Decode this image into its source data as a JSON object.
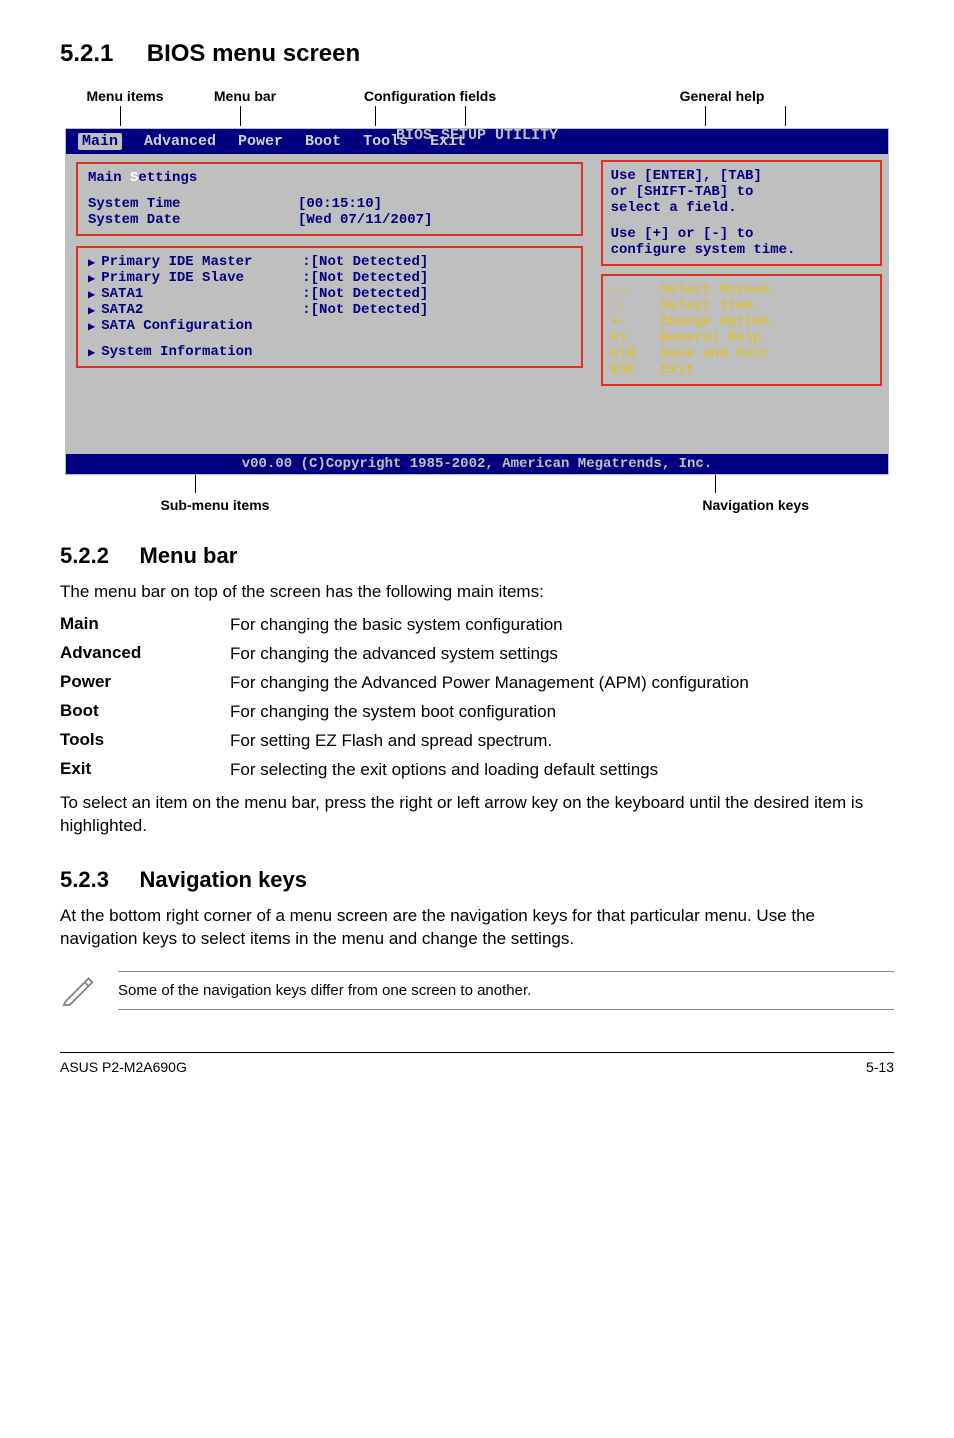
{
  "section": {
    "s1_num": "5.2.1",
    "s1_title": "BIOS menu screen",
    "s2_num": "5.2.2",
    "s2_title": "Menu bar",
    "s2_intro": "The menu bar on top of the screen has the following main items:",
    "s2_outro": "To select an item on the menu bar, press the right or left arrow key on the keyboard until the desired item is highlighted.",
    "s3_num": "5.2.3",
    "s3_title": "Navigation keys",
    "s3_body": "At the bottom right corner of a menu screen are the navigation keys for that particular menu. Use the navigation keys to select items in the menu and change the settings.",
    "note": "Some of the navigation keys differ from one screen to another."
  },
  "top_labels": {
    "menu_items": "Menu items",
    "menu_bar": "Menu bar",
    "config_fields": "Configuration fields",
    "general_help": "General help"
  },
  "bottom_labels": {
    "sub_menu": "Sub-menu items",
    "nav_keys": "Navigation keys"
  },
  "bios": {
    "title": "BIOS SETUP UTILITY",
    "tabs": {
      "main": "Main",
      "advanced": "Advanced",
      "power": "Power",
      "boot": "Boot",
      "tools": "Tools",
      "exit": "Exit"
    },
    "left": {
      "main_settings": "Main Settings",
      "sys_time_k": "System Time",
      "sys_time_v": "[00:15:10]",
      "sys_date_k": "System Date",
      "sys_date_v": "[Wed 07/11/2007]",
      "items": {
        "i0_k": "Primary IDE Master",
        "i0_v": ":[Not Detected]",
        "i1_k": "Primary IDE Slave",
        "i1_v": ":[Not Detected]",
        "i2_k": "SATA1",
        "i2_v": ":[Not Detected]",
        "i3_k": "SATA2",
        "i3_v": ":[Not Detected]",
        "i4_k": "SATA Configuration",
        "i5_k": "System Information"
      }
    },
    "help": {
      "l1": "Use [ENTER], [TAB]",
      "l2": "or [SHIFT-TAB] to",
      "l3": "select a field.",
      "l4": "Use [+] or [-] to",
      "l5": "configure system time."
    },
    "nav": {
      "r0_k": "←→",
      "r0_d": "Select Screen",
      "r1_k": "↑↓",
      "r1_d": "Select Item",
      "r2_k": "+-",
      "r2_d": "Change Option",
      "r3_k": "F1",
      "r3_d": "General Help",
      "r4_k": "F10",
      "r4_d": "Save and Exit",
      "r5_k": "ESC",
      "r5_d": "Exit"
    },
    "footer": "v00.00 (C)Copyright 1985-2002, American Megatrends, Inc."
  },
  "defs": {
    "d0_t": "Main",
    "d0_d": "For changing the basic system configuration",
    "d1_t": "Advanced",
    "d1_d": "For changing the advanced system settings",
    "d2_t": "Power",
    "d2_d": "For changing the Advanced Power Management (APM) configuration",
    "d3_t": "Boot",
    "d3_d": "For changing the system boot configuration",
    "d4_t": "Tools",
    "d4_d": "For setting EZ Flash and spread spectrum.",
    "d5_t": "Exit",
    "d5_d": "For selecting the exit options and loading default settings"
  },
  "footer": {
    "product": "ASUS P2-M2A690G",
    "page": "5-13"
  }
}
